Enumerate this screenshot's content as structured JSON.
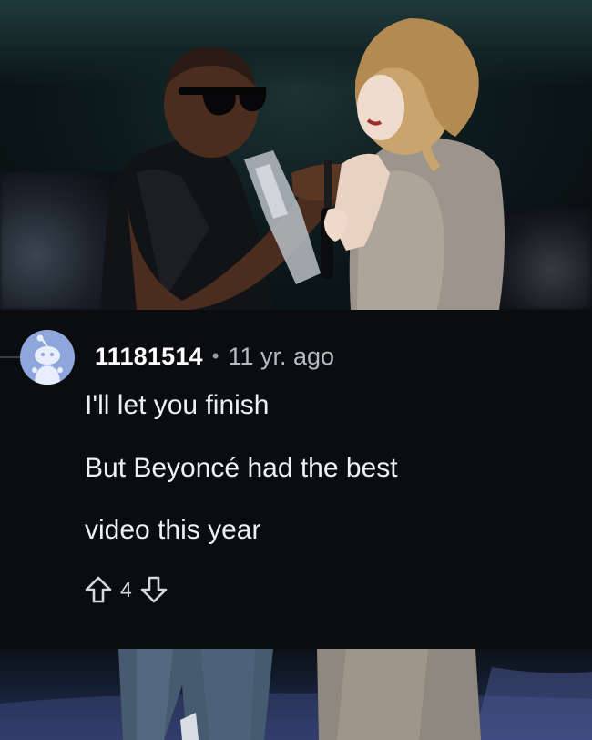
{
  "comment": {
    "username": "11181514",
    "separator": "•",
    "timestamp": "11 yr. ago",
    "lines": [
      "I'll let you finish",
      "But Beyoncé had the best",
      "video this year"
    ],
    "score": "4"
  },
  "icons": {
    "avatar": "reddit-snoo-avatar-icon",
    "upvote": "arrow-up-outline-icon",
    "downvote": "arrow-down-outline-icon"
  },
  "colors": {
    "card_background": "#0b0c10",
    "username": "#ffffff",
    "timestamp": "#b7bcc2",
    "body_text": "#eef0f2",
    "avatar_bg": "#8fa6dc"
  }
}
